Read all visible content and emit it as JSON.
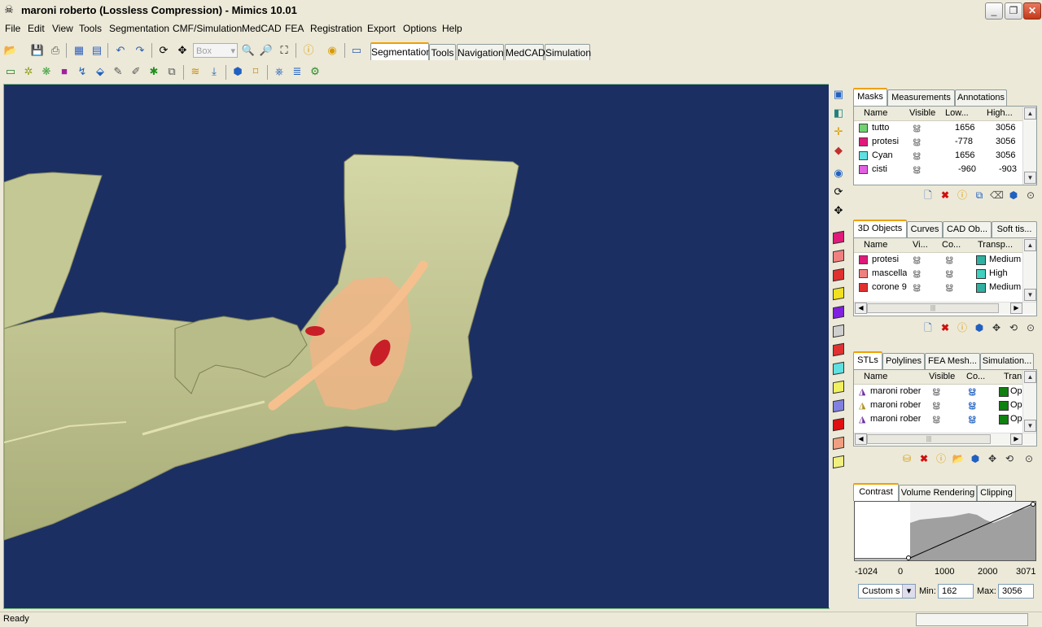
{
  "window": {
    "title": "maroni roberto (Lossless Compression) - Mimics  10.01",
    "app_icon": "skull-icon",
    "minimize": "_",
    "maximize": "❐",
    "close": "✕"
  },
  "menu": [
    "File",
    "Edit",
    "View",
    "Tools",
    "Segmentation",
    "CMF/Simulation",
    "MedCAD",
    "FEA",
    "Registration",
    "Export",
    "Options",
    "Help"
  ],
  "toolbar": {
    "box_combo": "Box",
    "mode_tabs": [
      "Segmentation",
      "Tools",
      "Navigation",
      "MedCAD",
      "Simulation"
    ],
    "active_mode": "Segmentation"
  },
  "masks_panel": {
    "tabs": [
      "Masks",
      "Measurements",
      "Annotations"
    ],
    "columns": [
      "Name",
      "Visible",
      "Low...",
      "High..."
    ],
    "rows": [
      {
        "name": "tutto",
        "low": "1656",
        "high": "3056",
        "color": "#6fd36f"
      },
      {
        "name": "protesi",
        "low": "-778",
        "high": "3056",
        "color": "#e0197a"
      },
      {
        "name": "Cyan",
        "low": "1656",
        "high": "3056",
        "color": "#5fe0e0"
      },
      {
        "name": "cisti",
        "low": "-960",
        "high": "-903",
        "color": "#e060e0"
      }
    ]
  },
  "objects_panel": {
    "tabs": [
      "3D Objects",
      "Curves",
      "CAD Ob...",
      "Soft tis..."
    ],
    "columns": [
      "Name",
      "Vi...",
      "Co...",
      "Transp..."
    ],
    "rows": [
      {
        "name": "protesi",
        "transparency": "Medium",
        "color": "#e0197a"
      },
      {
        "name": "mascella",
        "transparency": "High",
        "color": "#f08080"
      },
      {
        "name": "corone 9",
        "transparency": "Medium",
        "color": "#e03030"
      }
    ]
  },
  "stl_panel": {
    "tabs": [
      "STLs",
      "Polylines",
      "FEA Mesh...",
      "Simulation..."
    ],
    "columns": [
      "Name",
      "Visible",
      "Co...",
      "Tran"
    ],
    "rows": [
      {
        "name": "maroni rober",
        "transp": "Op"
      },
      {
        "name": "maroni rober",
        "transp": "Op"
      },
      {
        "name": "maroni rober",
        "transp": "Op"
      }
    ]
  },
  "contrast_panel": {
    "tabs": [
      "Contrast",
      "Volume Rendering",
      "Clipping"
    ],
    "axis_ticks": [
      "-1024",
      "0",
      "1000",
      "2000",
      "3071"
    ],
    "preset": "Custom s",
    "min_label": "Min:",
    "min_value": "162",
    "max_label": "Max:",
    "max_value": "3056"
  },
  "status": {
    "text": "Ready"
  },
  "colors": {
    "viewport_bg": "#1c2f63",
    "bone": "#c8cc98",
    "tab_accent": "#f0a000"
  }
}
